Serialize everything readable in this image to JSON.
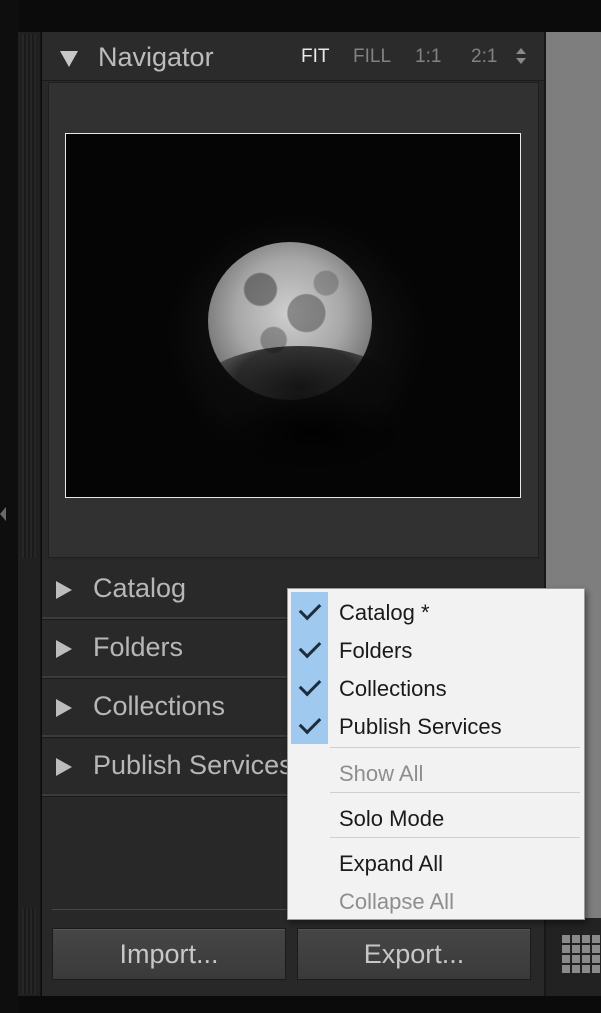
{
  "navigator": {
    "title": "Navigator",
    "zoom_options": [
      {
        "label": "FIT",
        "active": true
      },
      {
        "label": "FILL",
        "active": false
      },
      {
        "label": "1:1",
        "active": false
      },
      {
        "label": "2:1",
        "active": false
      }
    ]
  },
  "sections": [
    {
      "label": "Catalog"
    },
    {
      "label": "Folders"
    },
    {
      "label": "Collections"
    },
    {
      "label": "Publish Services"
    }
  ],
  "buttons": {
    "import_label": "Import...",
    "export_label": "Export..."
  },
  "context_menu": {
    "checked_items": [
      {
        "label": "Catalog *",
        "checked": true
      },
      {
        "label": "Folders",
        "checked": true
      },
      {
        "label": "Collections",
        "checked": true
      },
      {
        "label": "Publish Services",
        "checked": true
      }
    ],
    "show_all": "Show All",
    "solo_mode": "Solo Mode",
    "expand_all": "Expand All",
    "collapse_all": "Collapse All"
  },
  "colors": {
    "panel_bg": "#282828",
    "menu_bg": "#f2f2f2",
    "check_highlight": "#9fc9ef"
  }
}
